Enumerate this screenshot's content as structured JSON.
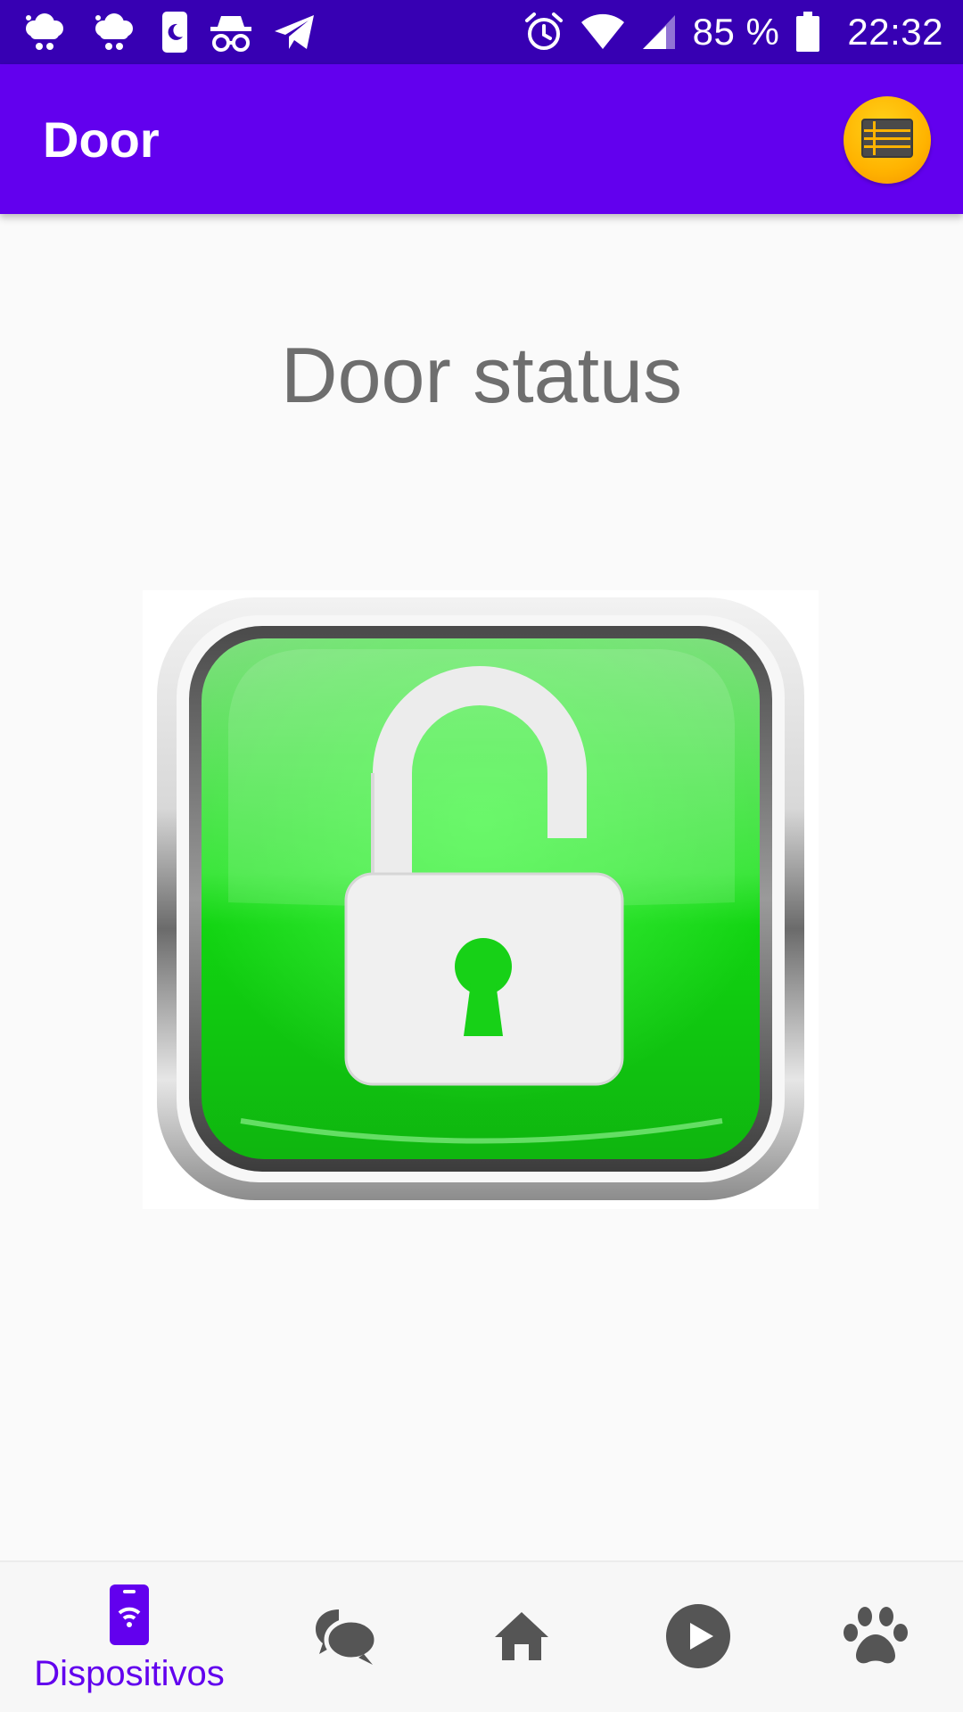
{
  "status_bar": {
    "battery_text": "85 %",
    "time": "22:32",
    "left_icons": [
      "weather-icon",
      "weather-icon",
      "phone-dnd-icon",
      "incognito-icon",
      "telegram-icon"
    ],
    "right_icons": [
      "alarm-icon",
      "wifi-icon",
      "signal-icon",
      "battery-icon"
    ]
  },
  "app_bar": {
    "title": "Door",
    "menu_icon": "list-icon"
  },
  "main": {
    "heading": "Door status",
    "lock_state": "unlocked"
  },
  "bottom_nav": {
    "items": [
      {
        "label": "Dispositivos",
        "icon": "phone-wifi-icon",
        "selected": true
      },
      {
        "label": "",
        "icon": "chat-icon",
        "selected": false
      },
      {
        "label": "",
        "icon": "home-icon",
        "selected": false
      },
      {
        "label": "",
        "icon": "play-icon",
        "selected": false
      },
      {
        "label": "",
        "icon": "paw-icon",
        "selected": false
      }
    ]
  },
  "colors": {
    "status_bar": "#3700b3",
    "app_bar": "#6200ee",
    "accent": "#6200ee",
    "lock_green": "#1fd11f",
    "menu_button": "#ffb300",
    "nav_inactive": "#555555"
  }
}
